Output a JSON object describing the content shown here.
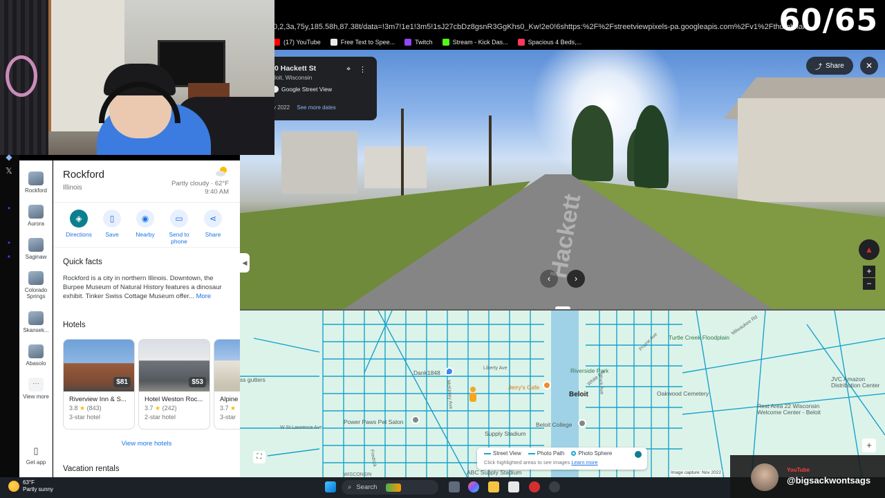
{
  "browser": {
    "url": "0,2,3a,75y,185.58h,87.38t/data=!3m7!1e1!3m5!1sJ27cbDz8gsnR3GgKhs0_Kw!2e0!6shttps:%2F%2Fstreetviewpixels-pa.googleapis.com%2Fv1%2Fthumbnail%3Fcb_client%3Dmaps_sv.t",
    "bookmarks": [
      {
        "label": "(17) YouTube",
        "color": "#ff0000"
      },
      {
        "label": "Free Text to Spee...",
        "color": "#e8eaed"
      },
      {
        "label": "Twitch",
        "color": "#9146ff"
      },
      {
        "label": "Stream - Kick Das...",
        "color": "#53fc18"
      },
      {
        "label": "Spacious 4 Beds,...",
        "color": "#ff385c"
      }
    ]
  },
  "overlay": {
    "counter": "60/65",
    "yt_brand": "YouTube",
    "yt_handle": "@bigsackwontsags"
  },
  "rail": {
    "items": [
      {
        "label": "Rockford"
      },
      {
        "label": "Aurora"
      },
      {
        "label": "Saginaw"
      },
      {
        "label": "Colorado Springs"
      },
      {
        "label": "Skansek..."
      },
      {
        "label": "Abasolo"
      },
      {
        "label": "View more"
      }
    ],
    "get_app": "Get app"
  },
  "place": {
    "title": "Rockford",
    "subtitle": "Illinois",
    "weather_desc": "Partly cloudy · 62°F",
    "time": "9:40 AM",
    "actions": [
      {
        "label": "Directions",
        "icon": "directions-icon"
      },
      {
        "label": "Save",
        "icon": "bookmark-icon"
      },
      {
        "label": "Nearby",
        "icon": "nearby-icon"
      },
      {
        "label": "Send to phone",
        "icon": "phone-icon"
      },
      {
        "label": "Share",
        "icon": "share-icon"
      }
    ],
    "quick_facts_title": "Quick facts",
    "quick_facts_text": "Rockford is a city in northern Illinois. Downtown, the Burpee Museum of Natural History features a dinosaur exhibit. Tinker Swiss Cottage Museum offer...",
    "quick_facts_more": "More",
    "hotels_title": "Hotels",
    "hotels": [
      {
        "name": "Riverview Inn & S...",
        "price": "$81",
        "rating": "3.8",
        "reviews": "(843)",
        "class": "3-star hotel"
      },
      {
        "name": "Hotel Weston Roc...",
        "price": "$53",
        "rating": "3.7",
        "reviews": "(242)",
        "class": "2-star hotel"
      },
      {
        "name": "Alpine",
        "price": "",
        "rating": "3.7",
        "reviews": "",
        "class": "3-star"
      }
    ],
    "view_more_hotels": "View more hotels",
    "vacation_title": "Vacation rentals"
  },
  "streetview": {
    "address": "0 Hackett St",
    "locality": "loit, Wisconsin",
    "gsv_label": "Google Street View",
    "date": "v 2022",
    "see_more": "See more dates",
    "share_label": "Share",
    "road_text": "Hackett"
  },
  "map": {
    "labels": {
      "riverside": "Riverside Park",
      "beloit": "Beloit",
      "oakwood": "Oakwood Cemetery",
      "turtle": "Turtle Creek Floodplain",
      "restarea": "Rest Area 22 Wisconsin Welcome Center - Beloit",
      "jvc": "JVC Amazon Distribution Center",
      "jerrys": "Jerry's Cafe",
      "dank": "Dank1848",
      "beloit_college": "Beloit College",
      "pet_salon": "Power Paws Pet Salon",
      "supply": "Supply Stadium",
      "abc": "ABC Supply Stadium",
      "gutters": "ss gutters",
      "lawrence": "W St Lawrence Ave",
      "liberty": "Liberty Ave",
      "mckinley": "McKinley Ave",
      "white": "White Ave",
      "prairie": "Prairie Ave",
      "park_ave": "Park Ave",
      "milwaukee": "Milwaukee Rd",
      "wisconsin": "WISCONSIN",
      "fredrick": "Fredrick"
    },
    "legend": {
      "street_view": "Street View",
      "photo_path": "Photo Path",
      "photo_sphere": "Photo Sphere",
      "hint": "Click highlighted areas to see images",
      "learn_more": "Learn more"
    },
    "capture": "Image capture: Nov 2022"
  },
  "taskbar": {
    "temp": "63°F",
    "weather": "Partly sunny",
    "search": "Search"
  }
}
